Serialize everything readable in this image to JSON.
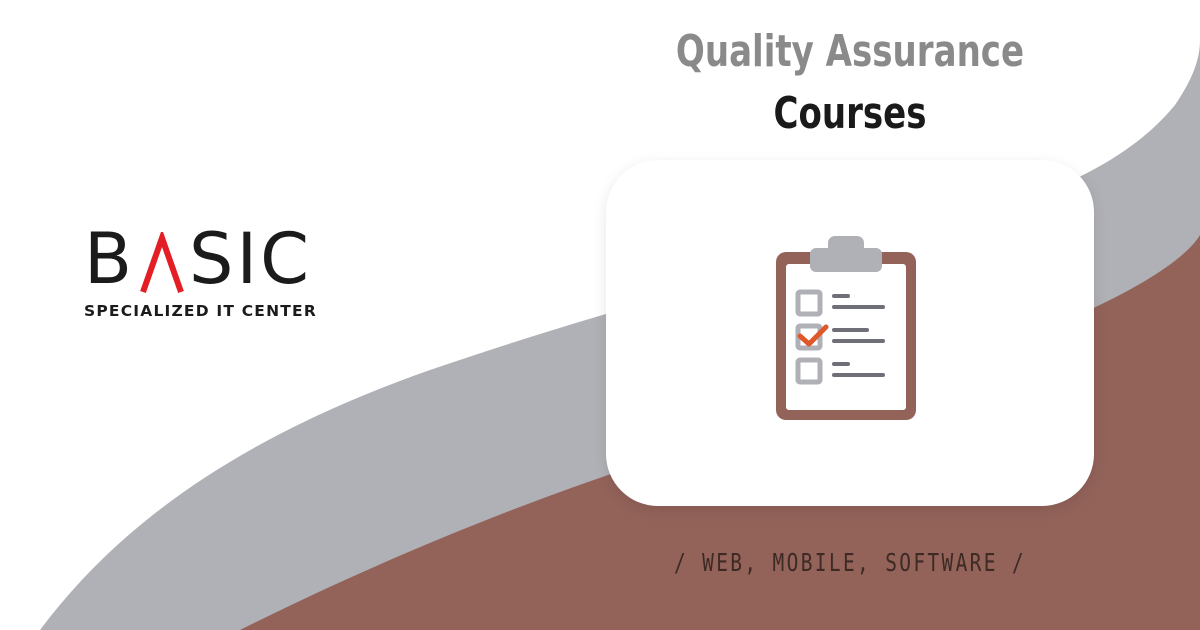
{
  "brand": {
    "word_left": "B",
    "word_right": "SIC",
    "subtitle": "SPECIALIZED IT CENTER",
    "accent_color": "#e31e24"
  },
  "headline": {
    "line1": "Quality Assurance",
    "line2": "Courses"
  },
  "tagline": "/ WEB, MOBILE, SOFTWARE /",
  "icon": {
    "name": "checklist-clipboard-icon",
    "checked_item": 2,
    "item_count": 3
  },
  "colors": {
    "background": "#ffffff",
    "grey_wave": "#b0b1b6",
    "brown_wave": "#93635a",
    "title_grey": "#8a8a8a",
    "title_dark": "#1a1a1a",
    "check_orange": "#e0572a",
    "clipboard_frame": "#93635a"
  }
}
